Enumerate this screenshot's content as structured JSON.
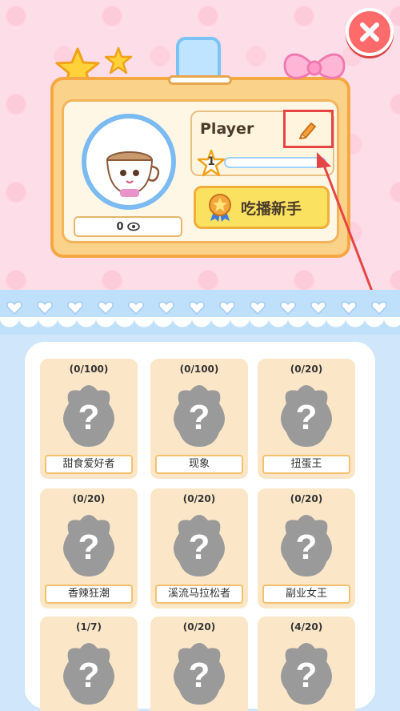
{
  "profile": {
    "name": "Player",
    "level": "1",
    "level_progress": 0,
    "view_count": "0",
    "title_label": "吃播新手"
  },
  "achievements": [
    {
      "count": "(0/100)",
      "label": "甜食爱好者"
    },
    {
      "count": "(0/100)",
      "label": "现象"
    },
    {
      "count": "(0/20)",
      "label": "扭蛋王"
    },
    {
      "count": "(0/20)",
      "label": "香辣狂潮"
    },
    {
      "count": "(0/20)",
      "label": "溪流马拉松者"
    },
    {
      "count": "(0/20)",
      "label": "副业女王"
    },
    {
      "count": "(1/7)",
      "label": ""
    },
    {
      "count": "(0/20)",
      "label": ""
    },
    {
      "count": "(4/20)",
      "label": ""
    }
  ],
  "colors": {
    "accent_close": "#ff6b6b",
    "card_border": "#f5a742",
    "title_button": "#fbe160",
    "highlight": "#e64545",
    "level_fill": "#3c8dde"
  }
}
